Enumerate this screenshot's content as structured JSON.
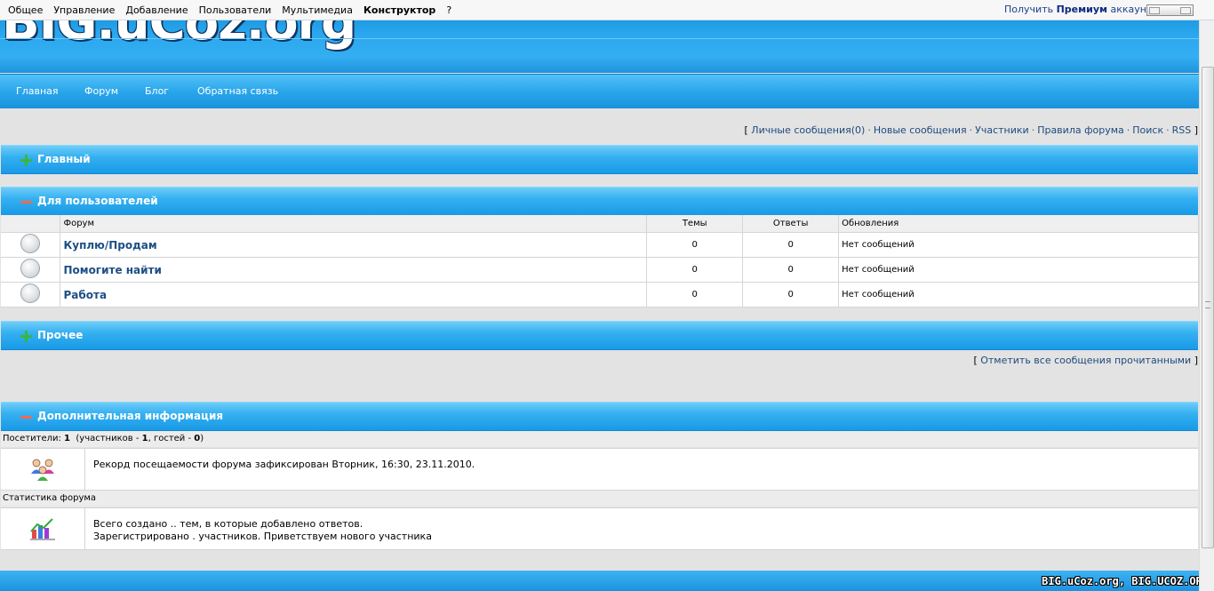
{
  "topbar": {
    "menu": [
      "Общее",
      "Управление",
      "Добавление",
      "Пользователи",
      "Мультимедиа",
      "Конструктор",
      "?"
    ],
    "premium_prefix": "Получить",
    "premium_bold": "Премиум",
    "premium_suffix": "аккаунт"
  },
  "header": {
    "logo_text": "BIG.uCoz.org"
  },
  "nav": [
    "Главная",
    "Форум",
    "Блог",
    "Обратная связь"
  ],
  "toplinks": {
    "open": "[",
    "items": [
      "Личные сообщения(0)",
      "Новые сообщения",
      "Участники",
      "Правила форума",
      "Поиск",
      "RSS"
    ],
    "close": "]"
  },
  "categories": {
    "main": "Главный",
    "users": "Для пользователей",
    "other": "Прочее",
    "extra": "Дополнительная информация"
  },
  "table": {
    "headers": [
      "Форум",
      "Темы",
      "Ответы",
      "Обновления"
    ],
    "rows": [
      {
        "name": "Куплю/Продам",
        "topics": "0",
        "replies": "0",
        "updates": "Нет сообщений"
      },
      {
        "name": "Помогите найти",
        "topics": "0",
        "replies": "0",
        "updates": "Нет сообщений"
      },
      {
        "name": "Работа",
        "topics": "0",
        "replies": "0",
        "updates": "Нет сообщений"
      }
    ]
  },
  "mark_read": {
    "open": "[",
    "label": "Отметить все сообщения прочитанными",
    "close": "]"
  },
  "visitors": {
    "prefix": "Посетители:",
    "total": "1",
    "members_text": "(участников -",
    "members": "1",
    "guests_text": ", гостей -",
    "guests": "0",
    "close": ")"
  },
  "record": {
    "text": "Рекорд посещаемости форума    зафиксирован Вторник, 16:30, 23.11.2010."
  },
  "stats": {
    "title": "Статистика форума",
    "line1": "Всего создано  .. тем, в которые добавлено    ответов.",
    "line2": "Зарегистрировано   . участников. Приветствуем нового участника"
  },
  "footer": {
    "watermark": "BIG.uCoz.org, BIG.UCOZ.ORG"
  },
  "colors": {
    "header_blue": "#2ba8ef",
    "link_blue": "#1d4a7c",
    "plus_green": "#37b83a",
    "minus_red": "#ef6a53"
  },
  "icons": {
    "main": "plus-icon",
    "users": "minus-icon",
    "other": "plus-icon",
    "extra": "minus-icon",
    "forum_status": "circle-status-icon",
    "visitors": "users-group-icon",
    "stats": "stats-chart-icon"
  }
}
